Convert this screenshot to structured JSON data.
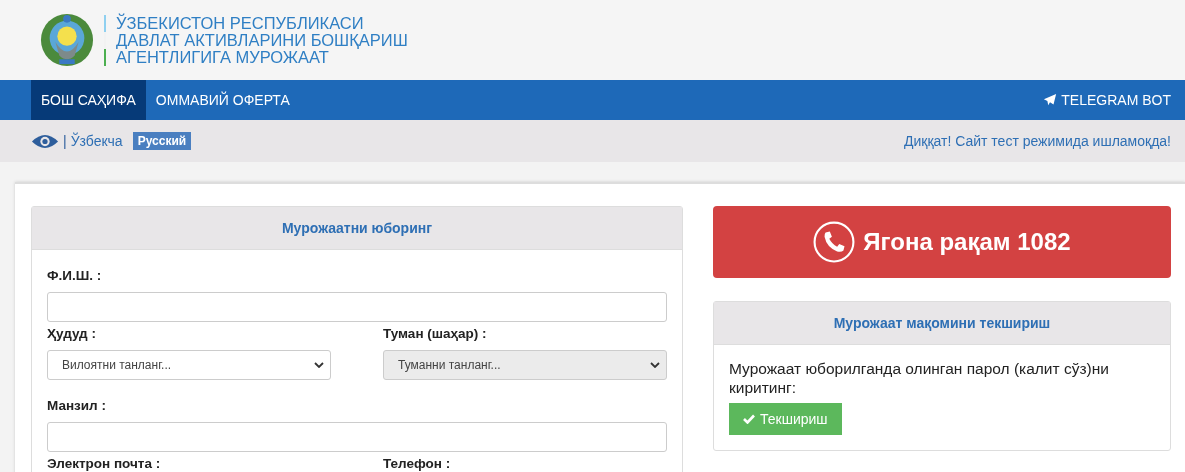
{
  "header": {
    "title_lines": [
      "ЎЗБЕКИСТОН РЕСПУБЛИКАСИ",
      "ДАВЛАТ АКТИВЛАРИНИ БОШҚАРИШ",
      "АГЕНТЛИГИГА МУРОЖААТ"
    ]
  },
  "nav": {
    "items": [
      {
        "label": "БОШ САҲИФА",
        "selected": true
      },
      {
        "label": "ОММАВИЙ ОФЕРТА",
        "selected": false
      }
    ],
    "telegram": "TELEGRAM BOT"
  },
  "lang_bar": {
    "separator": "|",
    "languages": [
      {
        "label": "Ўзбекча",
        "kind": "link"
      },
      {
        "label": "Русский",
        "kind": "badge"
      }
    ],
    "notice": "Диққат! Сайт тест режимида ишламоқда!"
  },
  "form": {
    "title": "Мурожаатни юборинг",
    "rows": [
      [
        {
          "label": "Ф.И.Ш. :",
          "kind": "input",
          "disabled": false
        }
      ],
      [
        {
          "label": "Ҳудуд :",
          "kind": "select",
          "placeholder": "Вилоятни танланг...",
          "disabled": false
        },
        {
          "label": "Туман (шаҳар) :",
          "kind": "select",
          "placeholder": "Туманни танланг...",
          "disabled": true
        }
      ],
      [
        {
          "label": "Манзил :",
          "kind": "input",
          "disabled": false
        }
      ],
      [
        {
          "label": "Электрон почта :",
          "kind": "cut"
        },
        {
          "label": "Телефон :",
          "kind": "cut"
        }
      ]
    ]
  },
  "hotline": {
    "label": "Ягона рақам 1082"
  },
  "status_check": {
    "title": "Мурожаат мақомини текшириш",
    "prompt": "Мурожаат юборилганда олинган парол (калит сўз)ни киритинг:",
    "button": "Текшириш"
  }
}
